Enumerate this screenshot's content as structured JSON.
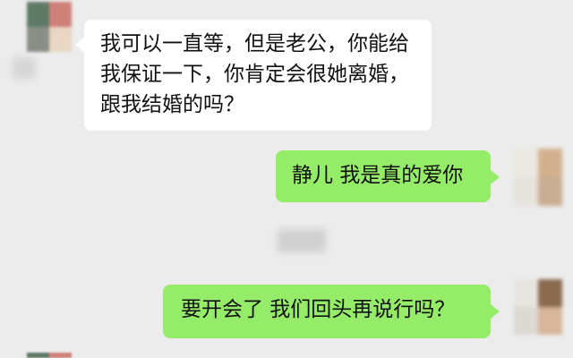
{
  "conversation": {
    "messages": [
      {
        "sender": "contact",
        "lines": [
          "我可以一直等，但是老公，你能给",
          "我保证一下，你肯定会很她离婚，",
          "跟我结婚的吗？"
        ]
      },
      {
        "sender": "me",
        "text": "静儿 我是真的爱你"
      },
      {
        "sender": "me",
        "text": "要开会了 我们回头再说行吗？"
      }
    ]
  },
  "colors": {
    "background": "#ececec",
    "incoming_bubble": "#ffffff",
    "outgoing_bubble": "#95ec69"
  }
}
